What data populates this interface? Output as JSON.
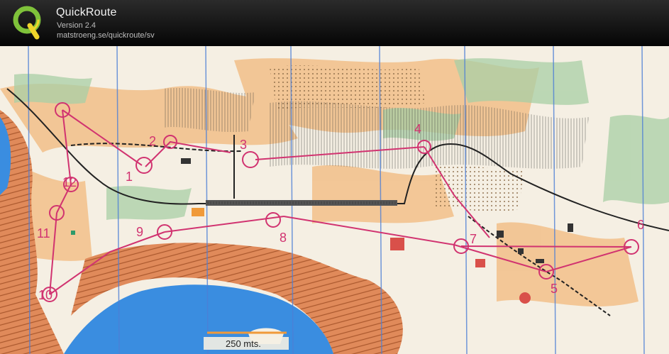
{
  "app": {
    "name": "QuickRoute",
    "version": "Version 2.4",
    "url": "matstroeng.se/quickroute/sv"
  },
  "map": {
    "scale_label": "250 mts.",
    "controls": [
      "1",
      "2",
      "3",
      "4",
      "5",
      "6",
      "7",
      "8",
      "9",
      "10",
      "11",
      "12"
    ]
  },
  "colors": {
    "course": "#d13370",
    "water": "#3a8de0",
    "contour": "#b86a3a"
  }
}
